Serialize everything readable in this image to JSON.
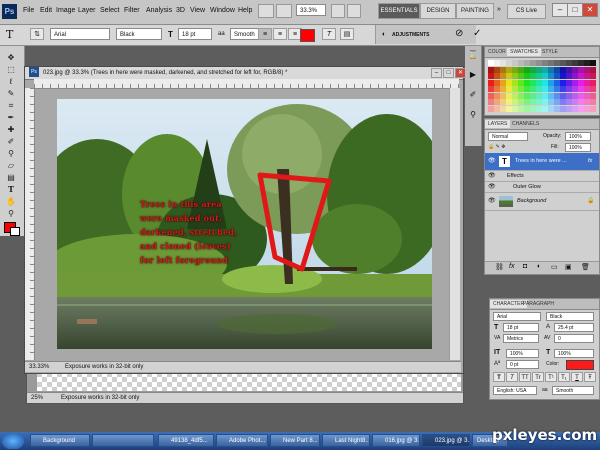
{
  "app": {
    "logo": "Ps",
    "menu": [
      "File",
      "Edit",
      "Image",
      "Layer",
      "Select",
      "Filter",
      "Analysis",
      "3D",
      "View",
      "Window",
      "Help"
    ],
    "zoom_field": "33.3%",
    "workspaces": [
      "ESSENTIALS",
      "DESIGN",
      "PAINTING"
    ],
    "cs_live": "CS Live",
    "window_controls": [
      "–",
      "□",
      "✕"
    ]
  },
  "options_bar": {
    "text_tool": "T",
    "font_family": "Arial",
    "font_style": "Black",
    "font_size": "18 pt",
    "antialias": "Smooth",
    "text_color": "#ff0000",
    "adjustments_label": "ADJUSTMENTS"
  },
  "document_back": {
    "zoom": "25%",
    "status": "Exposure works in 32-bit only"
  },
  "document_front": {
    "title": "023.jpg @ 33.3% (Trees in here were masked, darkened, and stretched for left for, RGB/8) *",
    "zoom": "33.33%",
    "status": "Exposure works in 32-bit only"
  },
  "image_caption": {
    "lines": [
      "Trees in this area",
      "were masked out,",
      "darkened, stretched,",
      "and cloned (leaves)",
      "for left foreground"
    ]
  },
  "swatches_panel": {
    "tabs": [
      "COLOR",
      "SWATCHES",
      "STYLE"
    ]
  },
  "layers_panel": {
    "tabs": [
      "LAYERS",
      "CHANNELS"
    ],
    "blend_mode": "Normal",
    "opacity_label": "Opacity:",
    "opacity": "100%",
    "fill_label": "Fill:",
    "fill": "100%",
    "layers": [
      {
        "name": "Trees in here were ...",
        "type": "text",
        "fx": "fx"
      },
      {
        "name": "Effects",
        "type": "effect-group"
      },
      {
        "name": "Outer Glow",
        "type": "effect"
      },
      {
        "name": "Background",
        "type": "image"
      }
    ]
  },
  "character_panel": {
    "tabs": [
      "CHARACTER",
      "PARAGRAPH"
    ],
    "font_family": "Arial",
    "font_style": "Black",
    "size": "18 pt",
    "leading": "25.4 pt",
    "kerning": "Metrics",
    "tracking": "0",
    "vscale": "100%",
    "hscale": "100%",
    "baseline": "0 pt",
    "color_label": "Color:",
    "color": "#ff1a1a",
    "styles": [
      "T",
      "T",
      "TT",
      "Tr",
      "T¹",
      "T₁",
      "T",
      "Ŧ"
    ],
    "language": "English: USA",
    "aa_icon": "aa",
    "antialias": "Smooth"
  },
  "taskbar": {
    "items": [
      "Background",
      "",
      "49138_4df5...",
      "Adobe Phot...",
      "New Part 8...",
      "Last Night8...",
      "016.jpg @ 3...",
      "023.jpg @ 3...",
      "Desktop"
    ]
  },
  "watermark": "pxleyes.com"
}
